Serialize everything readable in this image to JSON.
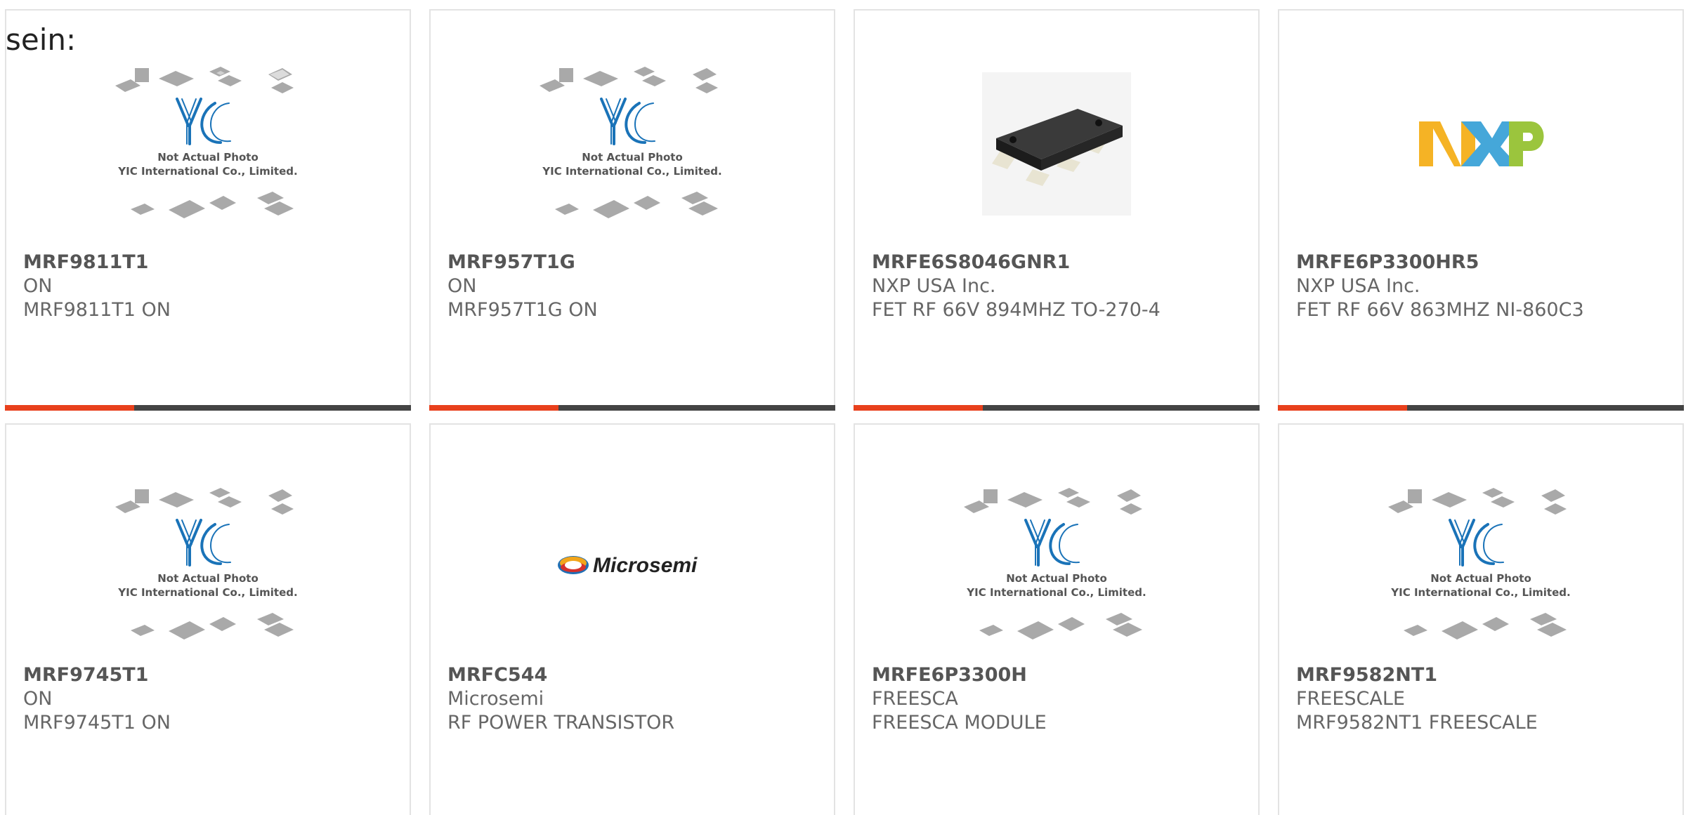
{
  "intro_text": "sein:",
  "colors": {
    "accent": "#e8401c",
    "bar": "#444444",
    "text": "#666666",
    "yic_blue": "#1a73b8",
    "border": "#e3e3e3"
  },
  "products": [
    {
      "part": "MRF9811T1",
      "maker": "ON",
      "desc": "MRF9811T1 ON",
      "image": "yic-placeholder",
      "caption1": "Not Actual Photo",
      "caption2": "YIC International Co., Limited."
    },
    {
      "part": "MRF957T1G",
      "maker": "ON",
      "desc": "MRF957T1G ON",
      "image": "yic-placeholder",
      "caption1": "Not Actual Photo",
      "caption2": "YIC International Co., Limited."
    },
    {
      "part": "MRFE6S8046GNR1",
      "maker": "NXP USA Inc.",
      "desc": "FET RF 66V 894MHZ TO-270-4",
      "image": "black-chip-photo"
    },
    {
      "part": "MRFE6P3300HR5",
      "maker": "NXP USA Inc.",
      "desc": "FET RF 66V 863MHZ NI-860C3",
      "image": "nxp-logo"
    },
    {
      "part": "MRF9745T1",
      "maker": "ON",
      "desc": "MRF9745T1 ON",
      "image": "yic-placeholder",
      "caption1": "Not Actual Photo",
      "caption2": "YIC International Co., Limited."
    },
    {
      "part": "MRFC544",
      "maker": "Microsemi",
      "desc": "RF POWER TRANSISTOR",
      "image": "microsemi-logo",
      "logo_text": "Microsemi"
    },
    {
      "part": "MRFE6P3300H",
      "maker": "FREESCA",
      "desc": "FREESCA MODULE",
      "image": "yic-placeholder",
      "caption1": "Not Actual Photo",
      "caption2": "YIC International Co., Limited."
    },
    {
      "part": "MRF9582NT1",
      "maker": "FREESCALE",
      "desc": "MRF9582NT1 FREESCALE",
      "image": "yic-placeholder",
      "caption1": "Not Actual Photo",
      "caption2": "YIC International Co., Limited."
    }
  ]
}
